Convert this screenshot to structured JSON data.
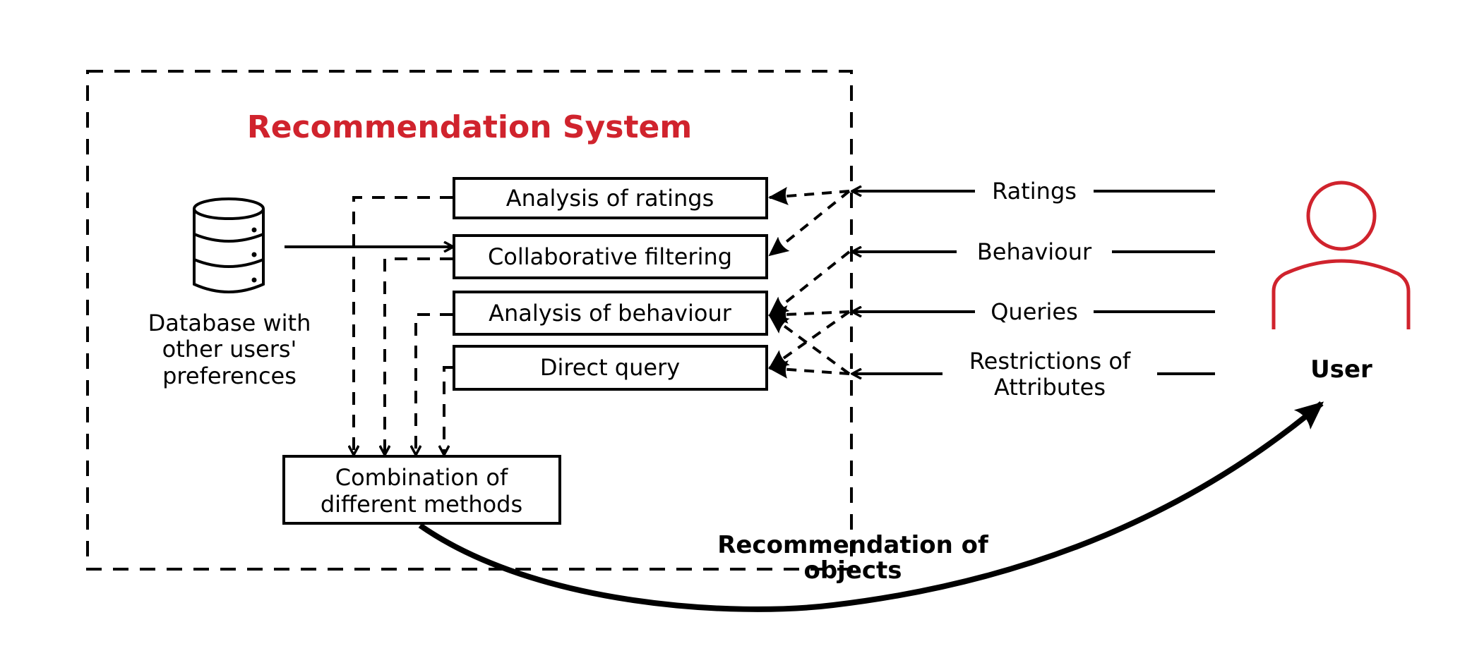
{
  "title": "Recommendation System",
  "database": {
    "icon": "database-icon",
    "label_lines": [
      "Database with",
      "other users'",
      "preferences"
    ]
  },
  "methods": [
    {
      "id": "ratings",
      "label": "Analysis of ratings"
    },
    {
      "id": "collaborative",
      "label": "Collaborative filtering"
    },
    {
      "id": "behaviour",
      "label": "Analysis of behaviour"
    },
    {
      "id": "query",
      "label": "Direct query"
    }
  ],
  "combination": {
    "label_lines": [
      "Combination of",
      "different methods"
    ]
  },
  "inputs": [
    {
      "label_lines": [
        "Ratings"
      ]
    },
    {
      "label_lines": [
        "Behaviour"
      ]
    },
    {
      "label_lines": [
        "Queries"
      ]
    },
    {
      "label_lines": [
        "Restrictions of",
        "Attributes"
      ]
    }
  ],
  "user": {
    "icon": "user-icon",
    "label": "User",
    "color": "#d0232d"
  },
  "output": {
    "label_lines": [
      "Recommendation of",
      "objects"
    ]
  },
  "colors": {
    "accent": "#d0232d",
    "ink": "#000000"
  }
}
